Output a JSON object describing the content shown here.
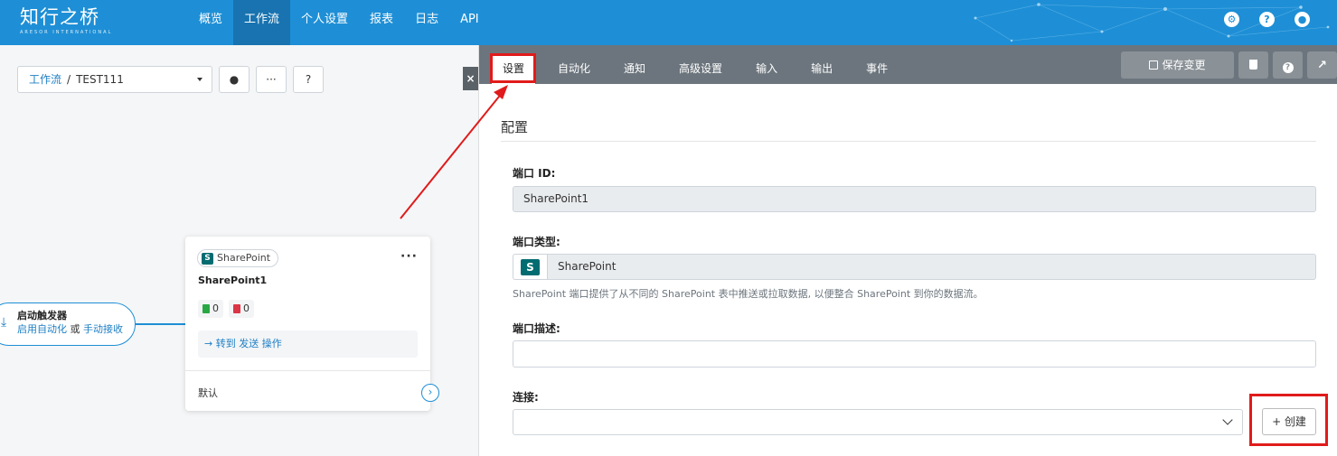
{
  "logo": {
    "name": "知行之桥",
    "subtitle": "ARESOR INTERNATIONAL"
  },
  "nav": {
    "items": [
      "概览",
      "工作流",
      "个人设置",
      "报表",
      "日志",
      "API"
    ],
    "active": "工作流"
  },
  "top_icons": [
    "gear-icon",
    "help-icon",
    "user-icon"
  ],
  "breadcrumb": {
    "root": "工作流",
    "separator": "/",
    "current": "TEST111"
  },
  "toolbar": {
    "user_icon": "user-icon",
    "more_label": "···",
    "help_label": "?"
  },
  "panel_close_label": "×",
  "trigger": {
    "title": "启动触发器",
    "link1": "启用自动化",
    "or": "或",
    "link2": "手动接收"
  },
  "card": {
    "tag": "SharePoint",
    "title": "SharePoint1",
    "success_count": "0",
    "error_count": "0",
    "goto_text": "→ 转到 发送 操作",
    "default_label": "默认",
    "more_label": "···",
    "next_label": "›"
  },
  "tabs": [
    "设置",
    "自动化",
    "通知",
    "高级设置",
    "输入",
    "输出",
    "事件"
  ],
  "active_tab": "设置",
  "actions": {
    "save_label": "保存变更"
  },
  "config": {
    "section_title": "配置",
    "port_id_label": "端口 ID:",
    "port_id_value": "SharePoint1",
    "port_type_label": "端口类型:",
    "port_type_value": "SharePoint",
    "help_text": "SharePoint 端口提供了从不同的 SharePoint 表中推送或拉取数据, 以便整合 SharePoint 到你的数据流。",
    "desc_label": "端口描述:",
    "desc_value": "",
    "conn_label": "连接:",
    "conn_value": "",
    "create_label": "+ 创建"
  },
  "colors": {
    "topbar": "#1e8fd6",
    "tabbar": "#6c757d",
    "highlight": "#e01b1b",
    "sharepoint": "#036c70"
  }
}
